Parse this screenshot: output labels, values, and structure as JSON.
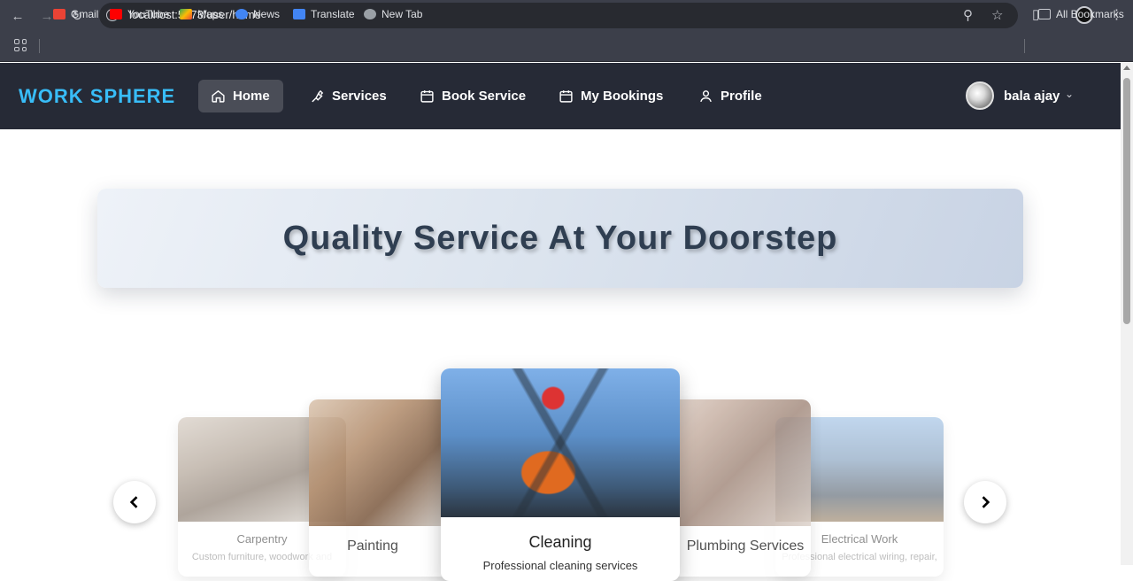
{
  "browser": {
    "url": "localhost:5173/user/home",
    "bookmarks": [
      {
        "label": "Gmail",
        "color": "#ea4335"
      },
      {
        "label": "YouTube",
        "color": "#ff0000"
      },
      {
        "label": "Maps",
        "color": "#34a853"
      },
      {
        "label": "News",
        "color": "#4285f4"
      },
      {
        "label": "Translate",
        "color": "#4285f4"
      },
      {
        "label": "New Tab",
        "color": "#9aa0a6"
      }
    ],
    "all_bookmarks": "All Bookmarks"
  },
  "navbar": {
    "brand": "WORK SPHERE",
    "items": [
      {
        "label": "Home",
        "icon": "home-icon",
        "active": true
      },
      {
        "label": "Services",
        "icon": "wrench-icon"
      },
      {
        "label": "Book Service",
        "icon": "calendar-icon"
      },
      {
        "label": "My Bookings",
        "icon": "calendar-icon"
      },
      {
        "label": "Profile",
        "icon": "user-icon"
      }
    ],
    "user_name": "bala ajay"
  },
  "hero": {
    "title": "Quality Service At Your Doorstep"
  },
  "carousel": {
    "cards": [
      {
        "title": "Carpentry",
        "desc": "Custom furniture, woodwork and"
      },
      {
        "title": "Painting",
        "desc": ""
      },
      {
        "title": "Cleaning",
        "desc": "Professional cleaning services"
      },
      {
        "title": "Plumbing Services",
        "desc": ""
      },
      {
        "title": "Electrical Work",
        "desc": "Professional electrical wiring, repair,"
      }
    ],
    "prev_label": "previous",
    "next_label": "next"
  },
  "colors": {
    "brand": "#38bdf8",
    "navbar_bg": "#262a36",
    "hero_text": "#2f3e51"
  }
}
